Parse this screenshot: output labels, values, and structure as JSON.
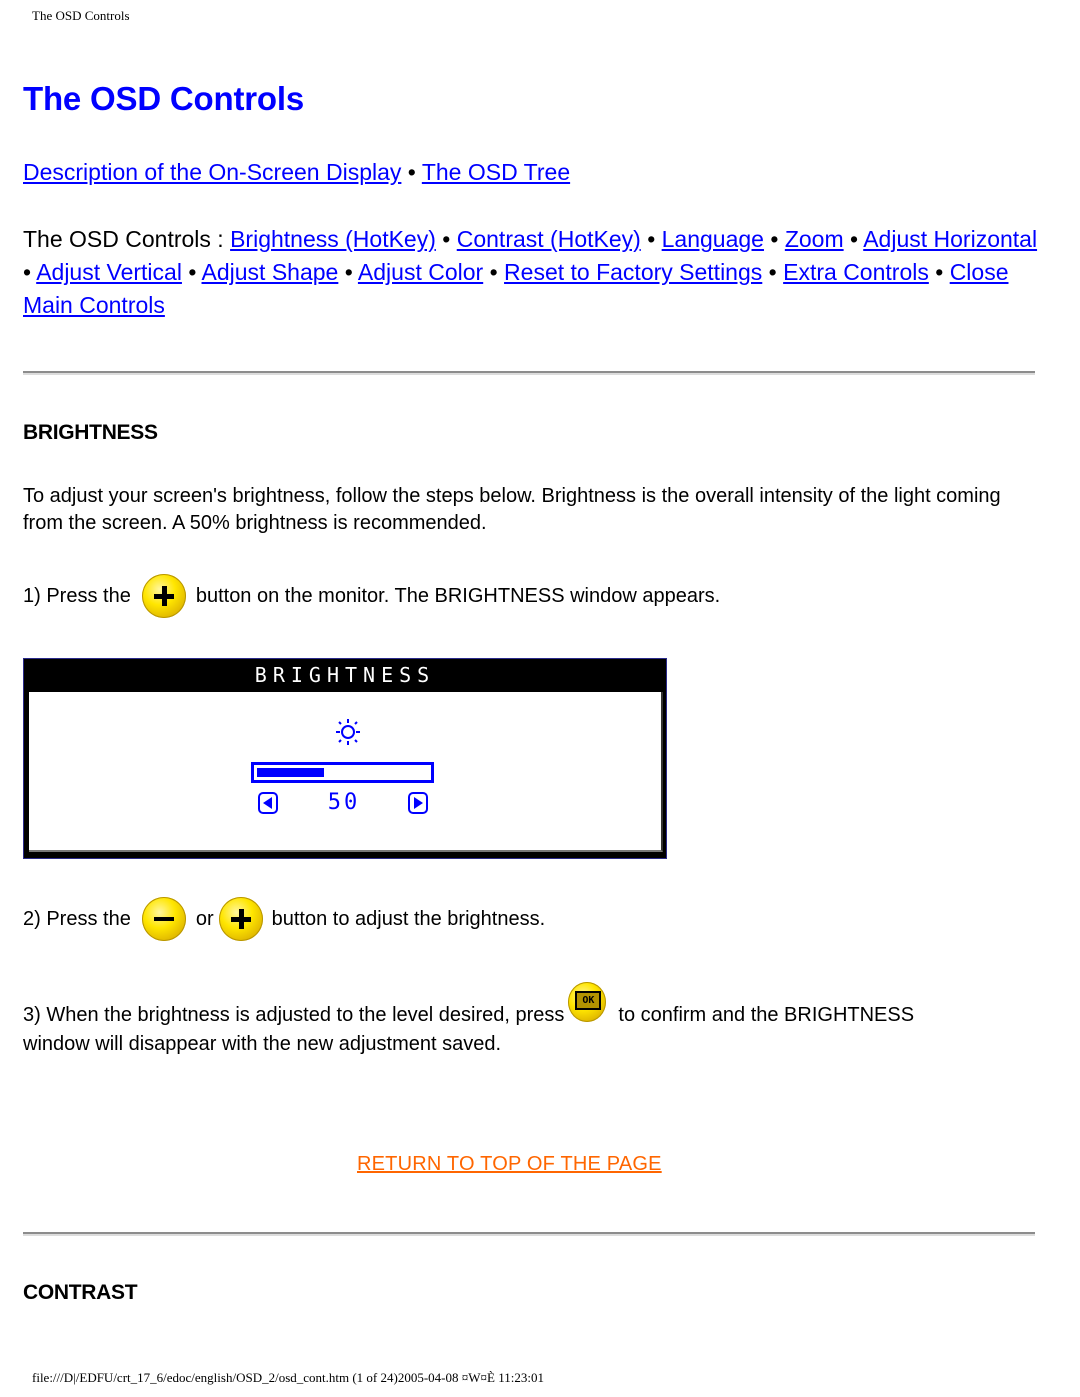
{
  "print_header": "The OSD Controls",
  "page_title": "The OSD Controls",
  "nav_primary": {
    "links": [
      {
        "label": "Description of the On-Screen Display"
      },
      {
        "label": "The OSD Tree"
      }
    ],
    "separator": "•"
  },
  "nav_controls": {
    "prefix": "The OSD Controls : ",
    "separator": "•",
    "links": [
      {
        "label": "Brightness (HotKey)"
      },
      {
        "label": "Contrast (HotKey)"
      },
      {
        "label": "Language"
      },
      {
        "label": "Zoom"
      },
      {
        "label": "Adjust Horizontal"
      },
      {
        "label": "Adjust Vertical"
      },
      {
        "label": "Adjust Shape"
      },
      {
        "label": "Adjust Color"
      },
      {
        "label": "Reset to Factory Settings"
      },
      {
        "label": "Extra Controls"
      },
      {
        "label": "Close Main Controls"
      }
    ]
  },
  "brightness_section": {
    "heading": "BRIGHTNESS",
    "intro": "To adjust your screen's brightness, follow the steps below. Brightness is the overall intensity of the light coming from the screen. A 50% brightness is recommended.",
    "step1": {
      "before": "1) Press the",
      "icon": "plus-button-icon",
      "after": "button on the monitor. The BRIGHTNESS window appears."
    },
    "osd_window": {
      "title": "BRIGHTNESS",
      "icon": "sun-icon",
      "value": "50",
      "level_fraction": 0.5,
      "accent_color": "#0000ff"
    },
    "step2": {
      "before": "2) Press the",
      "icon1": "minus-button-icon",
      "middle": "or",
      "icon2": "plus-button-icon",
      "after": "button to adjust the brightness."
    },
    "step3": {
      "before": "3) When the brightness is adjusted to the level desired, press",
      "icon": "ok-button-icon",
      "icon_text": "OK",
      "after": "to confirm and the BRIGHTNESS",
      "line2": "window will disappear with the new adjustment saved."
    },
    "return_link": "RETURN TO TOP OF THE PAGE"
  },
  "contrast_section": {
    "heading": "CONTRAST"
  },
  "print_footer": "file:///D|/EDFU/crt_17_6/edoc/english/OSD_2/osd_cont.htm (1 of 24)2005-04-08 ¤W¤È 11:23:01",
  "colors": {
    "link": "#0000ff",
    "return_link": "#ff6600",
    "title": "#0000ff",
    "button_yellow": "#ffe600"
  }
}
